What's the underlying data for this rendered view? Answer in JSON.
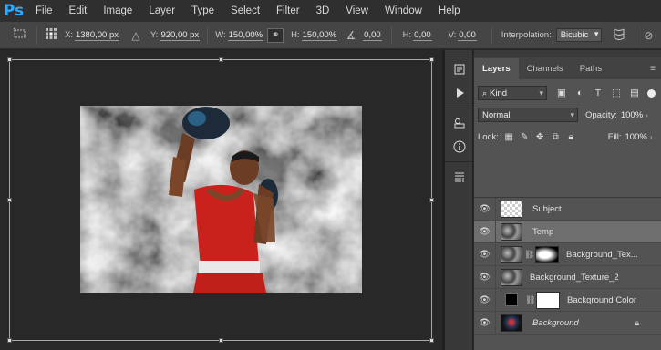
{
  "app": {
    "logo": "Ps"
  },
  "menu": [
    "File",
    "Edit",
    "Image",
    "Layer",
    "Type",
    "Select",
    "Filter",
    "3D",
    "View",
    "Window",
    "Help"
  ],
  "options": {
    "x_label": "X:",
    "x_value": "1380,00 px",
    "y_label": "Y:",
    "y_value": "920,00 px",
    "w_label": "W:",
    "w_value": "150,00%",
    "h_label": "H:",
    "h_value": "150,00%",
    "angle_value": "0,00",
    "hskew_label": "H:",
    "hskew_value": "0,00",
    "vskew_label": "V:",
    "vskew_value": "0,00",
    "interp_label": "Interpolation:",
    "interp_value": "Bicubic"
  },
  "layers_panel": {
    "tabs": [
      "Layers",
      "Channels",
      "Paths"
    ],
    "kind_label": "Kind",
    "blend_mode": "Normal",
    "opacity_label": "Opacity:",
    "opacity_value": "100%",
    "lock_label": "Lock:",
    "fill_label": "Fill:",
    "fill_value": "100%",
    "layers": [
      {
        "name": "Subject",
        "selected": false
      },
      {
        "name": "Temp",
        "selected": true
      },
      {
        "name": "Background_Tex...",
        "selected": false
      },
      {
        "name": "Background_Texture_2",
        "selected": false
      },
      {
        "name": "Background Color",
        "selected": false
      },
      {
        "name": "Background",
        "selected": false
      }
    ]
  },
  "colors": {
    "accent": "#31a8ff",
    "panel_bg": "#535353",
    "selected_layer": "#6e6e6e"
  }
}
